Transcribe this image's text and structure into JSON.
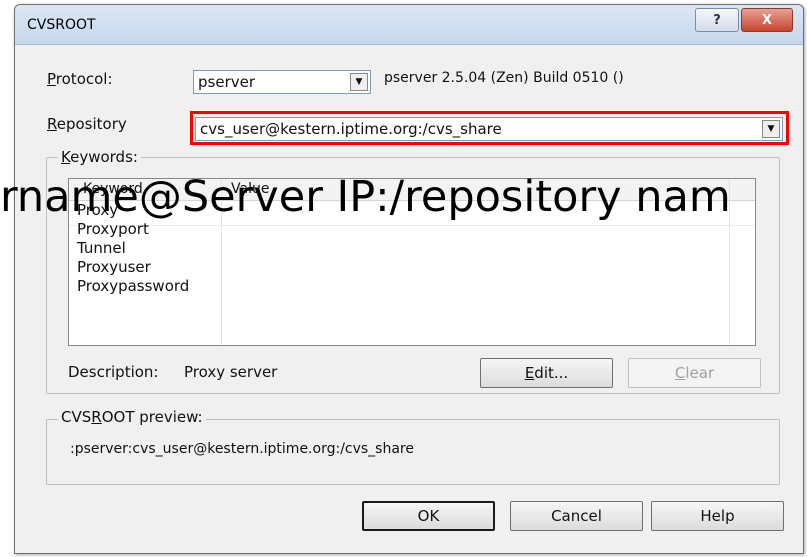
{
  "window": {
    "title": "CVSROOT"
  },
  "titlebar": {
    "help_glyph": "?",
    "close_glyph": "X"
  },
  "protocol": {
    "label_first": "P",
    "label_rest": "rotocol:",
    "value": "pserver",
    "version_text": "pserver 2.5.04 (Zen) Build 0510 ()"
  },
  "repository": {
    "label_first": "R",
    "label_rest": "epository",
    "value": "cvs_user@kestern.iptime.org:/cvs_share"
  },
  "keywords": {
    "legend_first": "K",
    "legend_rest": "eywords:",
    "columns": [
      "Keyword",
      "Value"
    ],
    "rows": [
      "Proxy",
      "Proxyport",
      "Tunnel",
      "Proxyuser",
      "Proxypassword"
    ],
    "description_label": "Description:",
    "description_value": "Proxy server",
    "edit_first": "E",
    "edit_rest": "dit...",
    "clear_first": "C",
    "clear_rest": "lear"
  },
  "preview": {
    "legend_before": "CVS",
    "legend_u": "R",
    "legend_after": "OOT preview:",
    "text": ":pserver:cvs_user@kestern.iptime.org:/cvs_share"
  },
  "buttons": {
    "ok": "OK",
    "cancel": "Cancel",
    "help": "Help"
  },
  "caption": "rname@Server IP:/repository nam",
  "colors": {
    "highlight": "#ff0000",
    "window_bg": "#f0f0f0",
    "close_red": "#c7452d"
  },
  "icons": {
    "dropdown": "chevron-down-icon"
  }
}
